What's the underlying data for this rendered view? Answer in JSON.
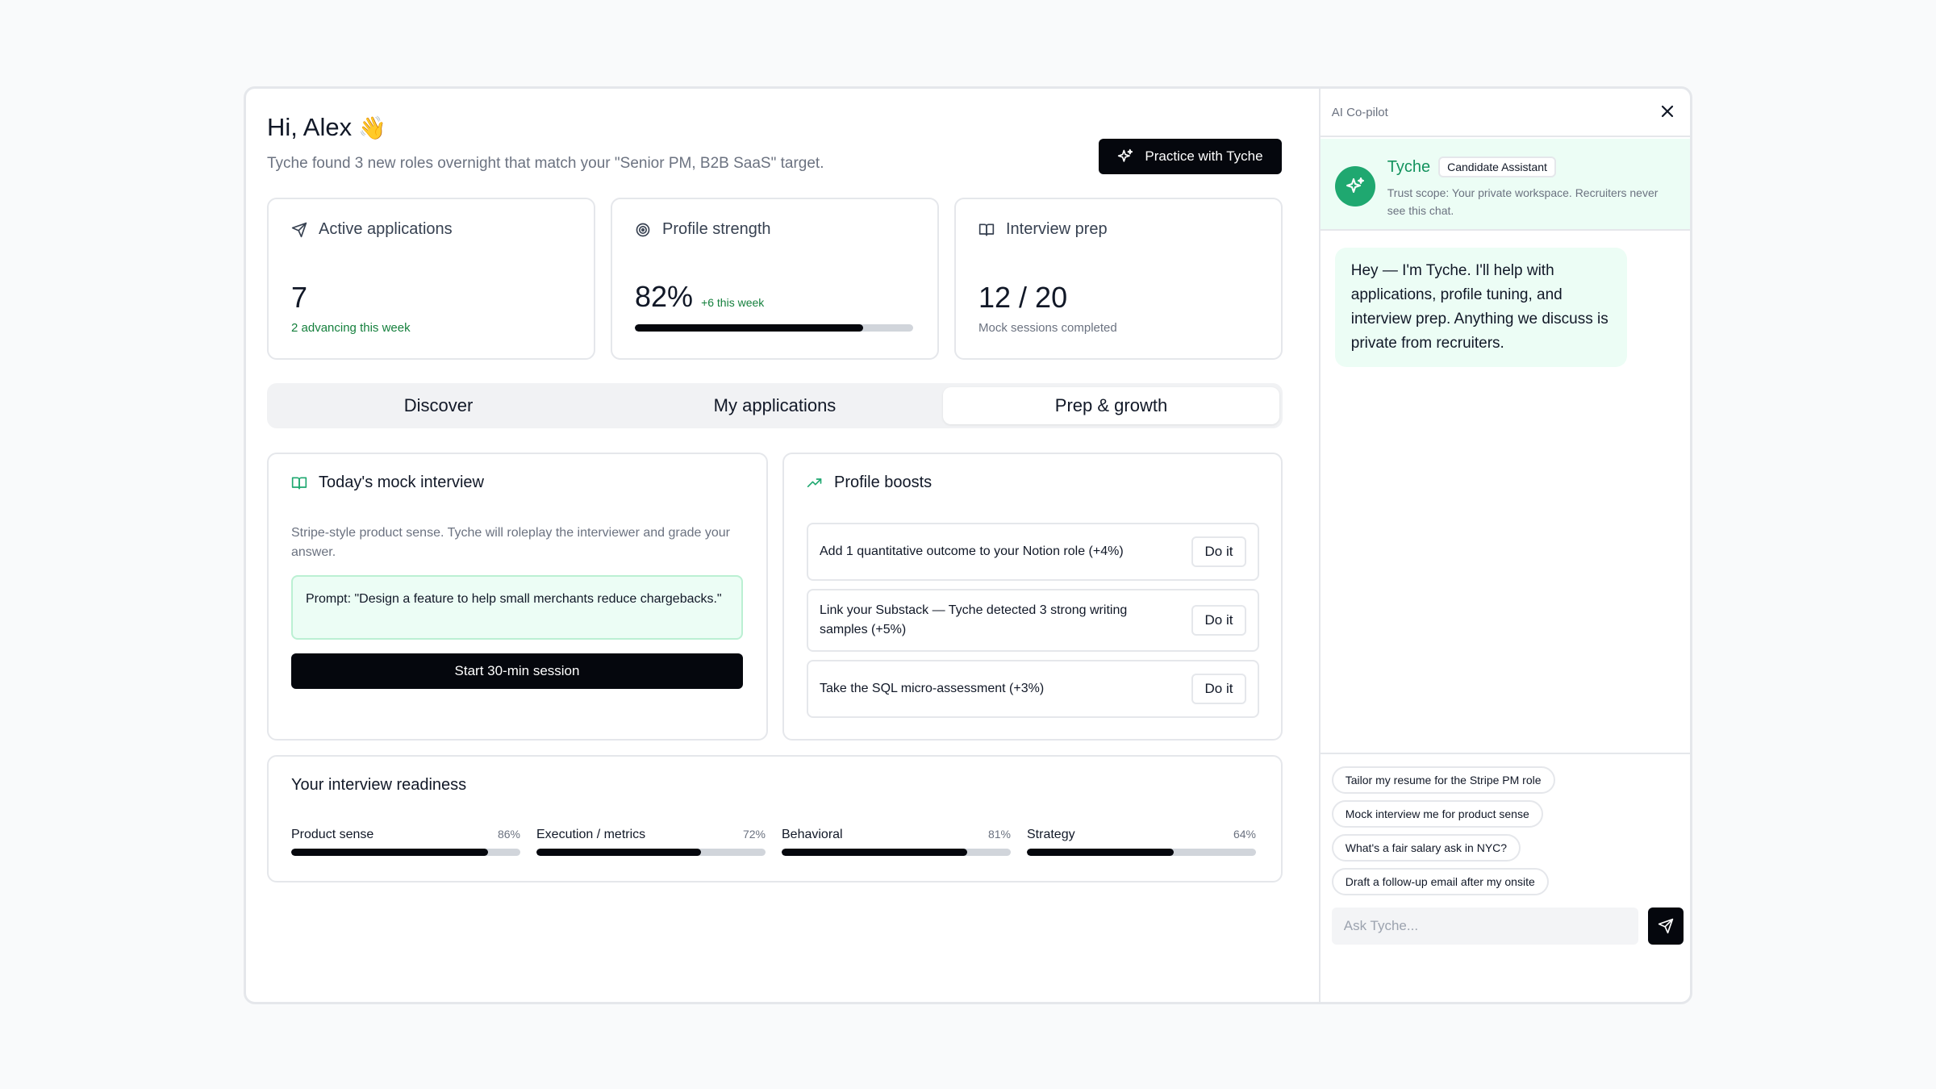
{
  "header": {
    "greeting": "Hi, Alex",
    "wave": "👋",
    "subtitle": "Tyche found 3 new roles overnight that match your \"Senior PM, B2B SaaS\" target.",
    "practice_label": "Practice with Tyche"
  },
  "stats": [
    {
      "label": "Active applications",
      "value": "7",
      "note": "2 advancing this week"
    },
    {
      "label": "Profile strength",
      "value": "82%",
      "delta": "+6 this week",
      "progress": 0.82
    },
    {
      "label": "Interview prep",
      "value": "12 / 20",
      "note": "Mock sessions completed"
    }
  ],
  "tabs": [
    {
      "label": "Discover",
      "active": false
    },
    {
      "label": "My applications",
      "active": false
    },
    {
      "label": "Prep & growth",
      "active": true
    }
  ],
  "mock": {
    "title": "Today's mock interview",
    "description": "Stripe-style product sense. Tyche will roleplay the interviewer and grade your answer.",
    "prompt": "Prompt: \"Design a feature to help small merchants reduce chargebacks.\"",
    "start_label": "Start 30-min session"
  },
  "boosts": {
    "title": "Profile boosts",
    "items": [
      {
        "text": "Add 1 quantitative outcome to your Notion role (+4%)",
        "action": "Do it"
      },
      {
        "text": "Link your Substack — Tyche detected 3 strong writing samples (+5%)",
        "action": "Do it"
      },
      {
        "text": "Take the SQL micro-assessment (+3%)",
        "action": "Do it"
      }
    ]
  },
  "readiness": {
    "title": "Your interview readiness",
    "metrics": [
      {
        "name": "Product sense",
        "pct": "86%",
        "value": 0.86
      },
      {
        "name": "Execution / metrics",
        "pct": "72%",
        "value": 0.72
      },
      {
        "name": "Behavioral",
        "pct": "81%",
        "value": 0.81
      },
      {
        "name": "Strategy",
        "pct": "64%",
        "value": 0.64
      }
    ]
  },
  "copilot": {
    "title": "AI Co-pilot",
    "assistant_name": "Tyche",
    "badge": "Candidate Assistant",
    "scope": "Trust scope: Your private workspace. Recruiters never see this chat.",
    "message": "Hey — I'm Tyche. I'll help with applications, profile tuning, and interview prep. Anything we discuss is private from recruiters.",
    "suggestions": [
      "Tailor my resume for the Stripe PM role",
      "Mock interview me for product sense",
      "What's a fair salary ask in NYC?",
      "Draft a follow-up email after my onsite"
    ],
    "input_placeholder": "Ask Tyche..."
  },
  "colors": {
    "accent_green": "#1fa870",
    "primary_button": "#05070d",
    "soft_green_bg": "#ecfdf5"
  }
}
